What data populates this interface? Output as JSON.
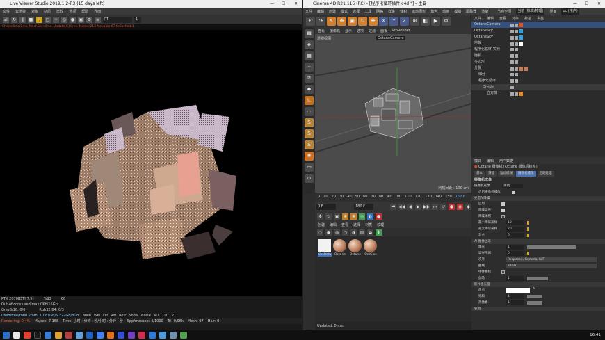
{
  "live_viewer": {
    "title": "Live Viewer Studio 2019.1.2-R3 (15 days left)",
    "menu": [
      "文件",
      "云渲染",
      "对象",
      "材质",
      "比较",
      "选项",
      "帮助",
      "界面"
    ],
    "preset": "PT",
    "toolbar_value": "1",
    "status_line": "Check:5ms/2ms. MeshGen:0ms. Update[C]:0ms. Nodes:213 Movable:67 txCached:1",
    "stats": {
      "gpu": "RTX 2070[DT][7.5]",
      "gpu_pct": "%93",
      "gpu_temp": "66",
      "ooc": "Out-of-core used/max:0Kb/16Gb",
      "grey": "Grey8/16: 0/0",
      "rgb": "Rgb32/64: 0/3",
      "vram": "Used/free/total vram: 1.081Gb/5.222Gb/8Gb",
      "tags": [
        "Main",
        "Wei",
        "Dif",
        "Ref",
        "Refr",
        "Shdw",
        "Noise",
        "ALL",
        "LUT",
        "Z"
      ],
      "rendering": "Rendering: 0.4%",
      "ms_sec": "Ms/sec: 7.168",
      "time": "Time: 小时 : 分钟 : 秒/小时 : 分钟 : 秒",
      "spp": "Spp/maxspp: 4/1000",
      "tri": "Tri: 0/96k",
      "mesh": "Mesh: 97",
      "hair": "Hair: 0"
    }
  },
  "c4d": {
    "title": "Cinema 4D R21.115 (RC) - [程序化循环插件.c4d *] - 主要",
    "menu": [
      "文件",
      "编辑",
      "创建",
      "模式",
      "选择",
      "工具",
      "网格",
      "样条",
      "体积",
      "运动图形",
      "角色",
      "动画",
      "模拟",
      "跟踪器",
      "渲染"
    ],
    "node_space": "节点空间",
    "node_space_value": "当前 (标准/物理)",
    "layout_label": "界面",
    "layout_value": "oc (用户)",
    "viewport_menu": [
      "查看",
      "摄像机",
      "显示",
      "选项",
      "过滤",
      "面板",
      "ProRender"
    ],
    "viewport_label": "透视视图",
    "camera_label": "OctaneCamera",
    "grid_spacing": "网格间距 : 100 cm",
    "timeline_ticks": [
      "0",
      "10",
      "20",
      "30",
      "40",
      "50",
      "60",
      "70",
      "80",
      "90",
      "100",
      "110",
      "120",
      "130",
      "140",
      "150"
    ],
    "current_frame": "152 F",
    "frame_start": "0 F",
    "frame_end": "180 F",
    "frame_field": "0 F",
    "material_menu": [
      "创建",
      "编辑",
      "查看",
      "选择",
      "材质",
      "纹理"
    ],
    "materials": [
      "OctDiffu",
      "Octane",
      "Octane",
      "OctGlos"
    ],
    "status": "Updated: 0 ms.",
    "object_manager": {
      "menu": [
        "文件",
        "编辑",
        "查看",
        "对象",
        "标签",
        "书签"
      ],
      "objects": [
        {
          "name": "OctaneCamera",
          "indent": 0,
          "color": "#ff7a30"
        },
        {
          "name": "OctaneSky",
          "indent": 0,
          "color": "#3ab0ff"
        },
        {
          "name": "OctaneSky",
          "indent": 0,
          "color": "#3ab0ff"
        },
        {
          "name": "地板",
          "indent": 0,
          "color": "#bbbbbb"
        },
        {
          "name": "程序化循环 实例",
          "indent": 0,
          "color": "#7ad060"
        },
        {
          "name": "随机",
          "indent": 0,
          "color": "#a070ff"
        },
        {
          "name": "多边形",
          "indent": 0,
          "color": "#7ad060"
        },
        {
          "name": "分裂",
          "indent": 0,
          "color": "#a070ff"
        },
        {
          "name": "细分",
          "indent": 1,
          "color": "#60c0ff"
        },
        {
          "name": "程序化循环",
          "indent": 1,
          "color": "#7ad060"
        },
        {
          "name": "Divider",
          "indent": 2,
          "color": "#7ad060"
        },
        {
          "name": "立方体",
          "indent": 3,
          "color": "#60c0ff"
        }
      ]
    },
    "attribute_manager": {
      "menu": [
        "模式",
        "编辑",
        "用户数据"
      ],
      "header": "Octane 摄像机 [Octane 摄像机标签]",
      "tabs": [
        "基本",
        "薄镜",
        "运动模糊",
        "摄像机成像",
        "后期处理"
      ],
      "active_tab": "摄像机成像",
      "section_title": "摄像机成像",
      "dropdown_row": {
        "label": "摄像机成像",
        "value": "薄镜"
      },
      "enable_imager": "启用摄像机成像",
      "sections": [
        "光谱AI降噪",
        "AI 图像上采",
        "胶片感光度",
        "色相"
      ],
      "params": [
        {
          "label": "启用",
          "type": "check"
        },
        {
          "label": "降噪高光",
          "type": "check"
        },
        {
          "label": "降噪体积",
          "type": "check"
        },
        {
          "label": "最小降噪采样",
          "value": "10"
        },
        {
          "label": "最大降噪采样",
          "value": "20"
        },
        {
          "label": "混合",
          "value": "0"
        }
      ],
      "imager_params": [
        {
          "label": "曝光",
          "value": "1."
        },
        {
          "label": "高光压缩",
          "value": "0"
        },
        {
          "label": "次序",
          "value": "Response, Gamma, LUT"
        },
        {
          "label": "曲线",
          "value": "sRGB"
        },
        {
          "label": "中性曲线",
          "value": ""
        },
        {
          "label": "伽马",
          "value": "1."
        }
      ],
      "color_params": [
        {
          "label": "白点",
          "value": ""
        },
        {
          "label": "饱和",
          "value": "1"
        },
        {
          "label": "热像素",
          "value": "1"
        }
      ]
    }
  },
  "taskbar": {
    "clock": "16:41",
    "icons": [
      "#2a6fc8",
      "#e8e8e8",
      "#e04030",
      "#1a1a1a",
      "#3a7ad8",
      "#e0a030",
      "#b04040",
      "#60a0e0",
      "#2060c0",
      "#4080f0",
      "#e07020",
      "#3050d0",
      "#7040c0",
      "#d03050",
      "#307ad8",
      "#4a9ae0",
      "#7090b0",
      "#50a050"
    ]
  }
}
